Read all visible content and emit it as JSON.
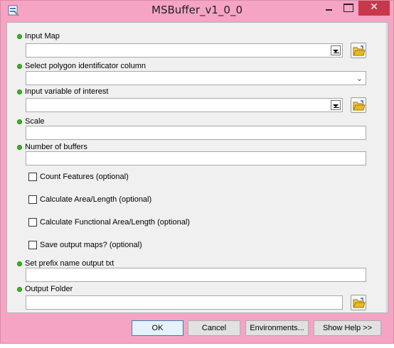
{
  "window": {
    "title": "MSBuffer_v1_0_0",
    "close_glyph": "✕"
  },
  "form": {
    "input_map": {
      "label": "Input Map",
      "value": ""
    },
    "polygon_column": {
      "label": "Select polygon identificator column",
      "value": ""
    },
    "input_variable": {
      "label": "Input variable of interest",
      "value": ""
    },
    "scale": {
      "label": "Scale",
      "value": ""
    },
    "num_buffers": {
      "label": "Number of buffers",
      "value": ""
    },
    "checkboxes": [
      {
        "label": "Count Features (optional)",
        "checked": false
      },
      {
        "label": "Calculate Area/Length (optional)",
        "checked": false
      },
      {
        "label": "Calculate Functional Area/Length (optional)",
        "checked": false
      },
      {
        "label": "Save output maps? (optional)",
        "checked": false
      }
    ],
    "prefix_name": {
      "label": "Set prefix name output txt",
      "value": ""
    },
    "output_folder": {
      "label": "Output Folder",
      "value": ""
    }
  },
  "buttons": {
    "ok": "OK",
    "cancel": "Cancel",
    "environments": "Environments...",
    "show_help": "Show Help >>"
  },
  "colors": {
    "title_bar": "#f5a4c4",
    "close_button": "#c7384a",
    "required_dot": "#3ab81f",
    "folder_icon": "#e8b923"
  },
  "icons": {
    "app": "tool-window-icon",
    "browse": "open-folder-icon",
    "combo": "dropdown-arrow-icon"
  }
}
